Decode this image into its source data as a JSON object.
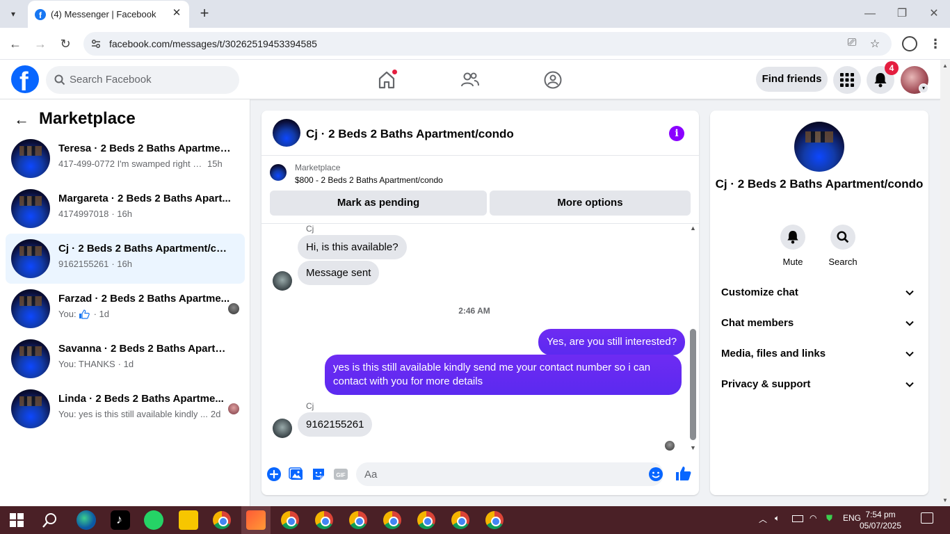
{
  "browser": {
    "tab_title": "(4) Messenger | Facebook",
    "url": "facebook.com/messages/t/30262519453394585"
  },
  "fb_header": {
    "search_placeholder": "Search Facebook",
    "find_friends_label": "Find friends",
    "notification_count": "4"
  },
  "left_panel": {
    "title": "Marketplace",
    "conversations": [
      {
        "name": "Teresa · 2 Beds 2 Baths Apartment...",
        "snippet": "417-499-0772 I'm swamped right no...",
        "time": "15h"
      },
      {
        "name": "Margareta · 2 Beds 2 Baths Apart...",
        "snippet": "4174997018",
        "time": "· 16h"
      },
      {
        "name": "Cj · 2 Beds 2 Baths Apartment/con...",
        "snippet": "9162155261",
        "time": "· 16h"
      },
      {
        "name": "Farzad · 2 Beds 2 Baths Apartme...",
        "snippet": "You:",
        "time": "· 1d"
      },
      {
        "name": "Savanna · 2 Beds 2 Baths Apartme...",
        "snippet": "You: THANKS",
        "time": "· 1d"
      },
      {
        "name": "Linda · 2 Beds 2 Baths Apartme...",
        "snippet": "You: yes is this still available kindly ...",
        "time": "2d"
      }
    ]
  },
  "chat": {
    "title": "Cj · 2 Beds 2 Baths Apartment/condo",
    "marketplace_label": "Marketplace",
    "listing": "$800 - 2 Beds 2 Baths Apartment/condo",
    "mark_pending_label": "Mark as pending",
    "more_options_label": "More options",
    "sender_name": "Cj",
    "msg_in_1": "Hi, is this available?",
    "msg_in_2": "Message sent",
    "timestamp": "2:46 AM",
    "msg_out_1": "Yes, are you still interested?",
    "msg_out_2": "yes is this still available kindly send me your contact number so i can contact with you for more details",
    "msg_in_3": "9162155261",
    "composer_placeholder": "Aa"
  },
  "info_panel": {
    "name": "Cj · 2 Beds 2 Baths Apartment/condo",
    "mute_label": "Mute",
    "search_label": "Search",
    "rows": [
      "Customize chat",
      "Chat members",
      "Media, files and links",
      "Privacy & support"
    ]
  },
  "taskbar": {
    "language": "ENG",
    "time": "7:54 pm",
    "date": "05/07/2025"
  },
  "colors": {
    "accent": "#0866ff",
    "outgoing_bubble": "#5b2af0",
    "badge": "#e41e3f",
    "taskbar": "#4a2026"
  }
}
